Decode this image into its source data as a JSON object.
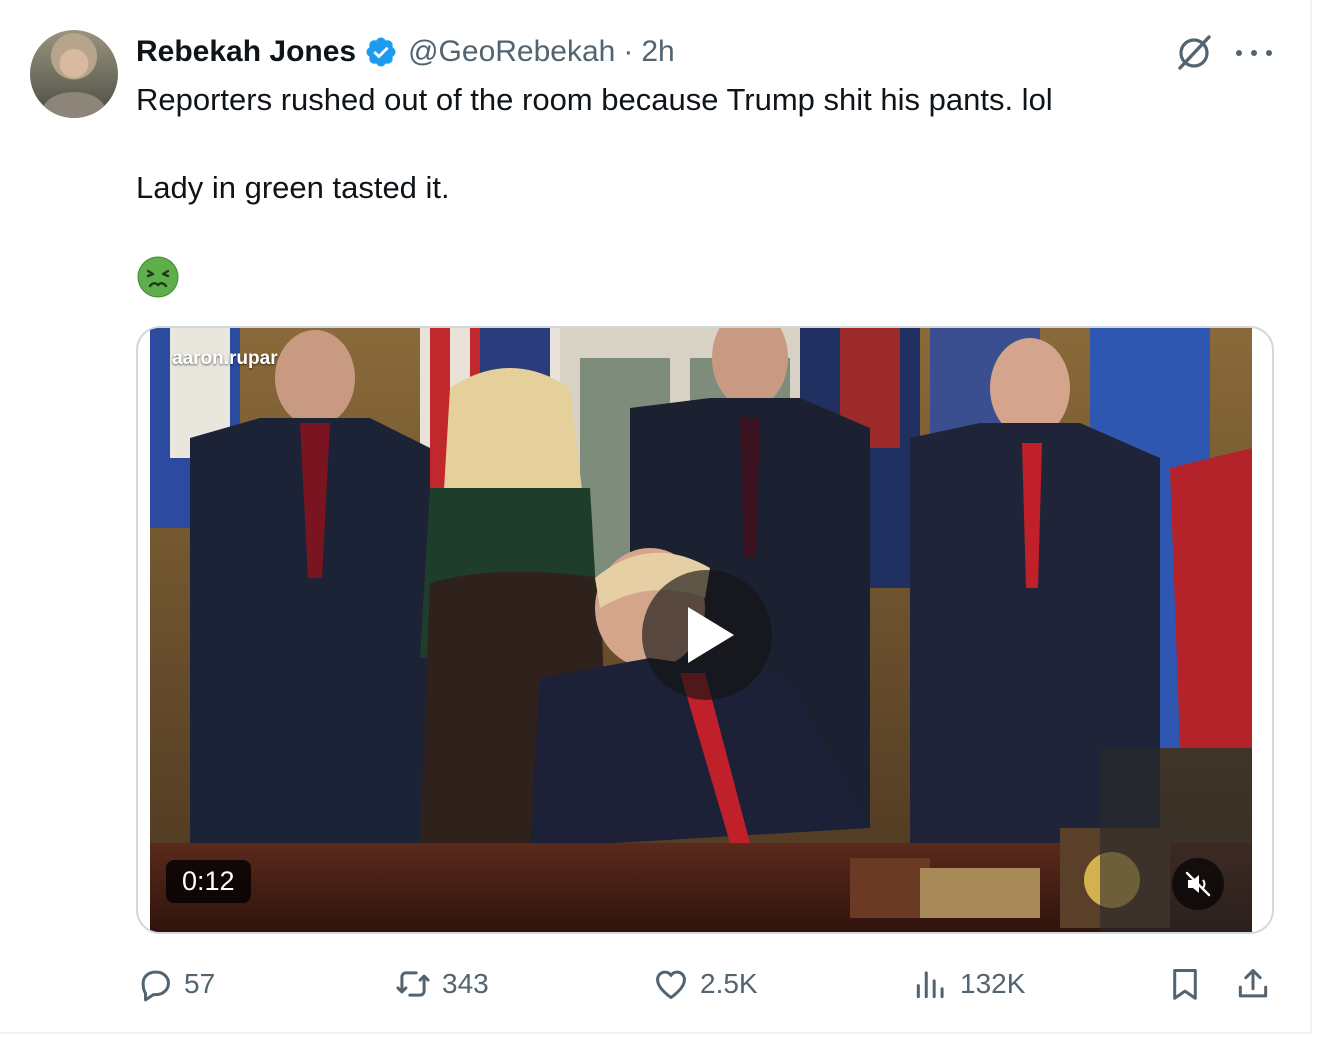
{
  "author": {
    "name": "Rebekah Jones",
    "handle": "@GeoRebekah",
    "separator": "·",
    "time": "2h"
  },
  "tweet": {
    "line1": "Reporters rushed out of the room because Trump shit his pants. lol",
    "line2": "Lady in green tasted it.",
    "emoji": "nauseated-face"
  },
  "media": {
    "watermark": "aaron.rupar",
    "duration": "0:12",
    "muted": true
  },
  "actions": {
    "replies": "57",
    "reposts": "343",
    "likes": "2.5K",
    "views": "132K"
  },
  "colors": {
    "text": "#0f1419",
    "secondary": "#536471",
    "verified": "#1d9bf0",
    "border": "#cfd9de"
  }
}
